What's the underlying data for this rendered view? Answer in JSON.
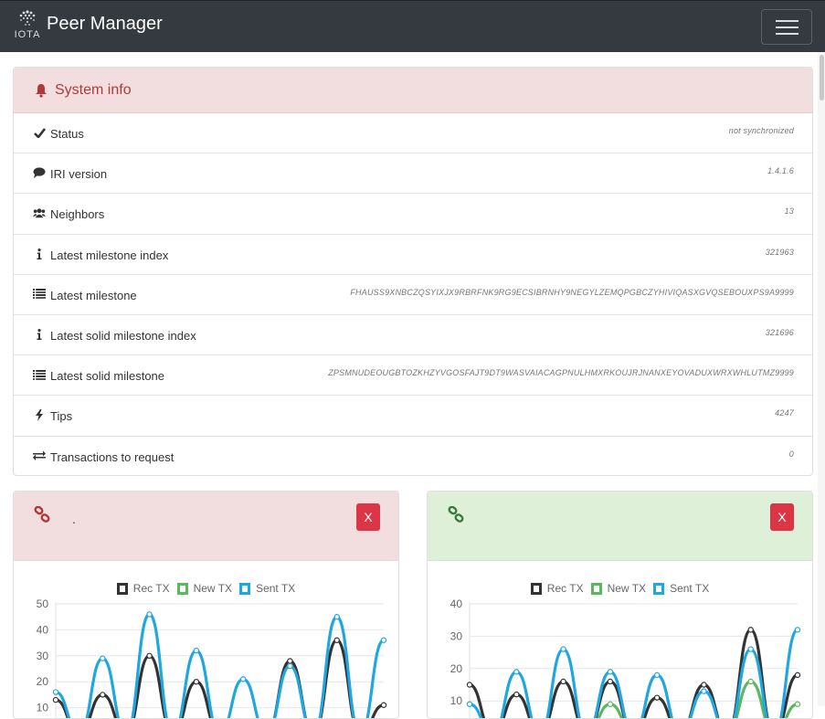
{
  "navbar": {
    "logo_text": "IOTA",
    "title": "Peer Manager",
    "menu_icon": "hamburger-icon"
  },
  "system_info": {
    "header": "System info",
    "header_icon": "bell-icon",
    "rows": [
      {
        "icon": "check-icon",
        "label": "Status",
        "value": "not synchronized"
      },
      {
        "icon": "comment-icon",
        "label": "IRI version",
        "value": "1.4.1.6"
      },
      {
        "icon": "users-icon",
        "label": "Neighbors",
        "value": "13"
      },
      {
        "icon": "info-icon",
        "label": "Latest milestone index",
        "value": "321963"
      },
      {
        "icon": "hash-icon",
        "label": "Latest milestone",
        "value": "FHAUSS9XNBCZQSYIXJX9RBRFNK9RG9ECSIBRNHY9NEGYLZEMQPGBCZYHIVIQASXGVQSEBOUXPS9A9999"
      },
      {
        "icon": "info-icon",
        "label": "Latest solid milestone index",
        "value": "321696"
      },
      {
        "icon": "hash-icon",
        "label": "Latest solid milestone",
        "value": "ZPSMNUDEOUGBTOZKHZYVGOSFAJT9DT9WASVAIACAGPNULHMXRKOUJRJNANXEYOVADUXWRXWHLUTMZ9999"
      },
      {
        "icon": "bolt-icon",
        "label": "Tips",
        "value": "4247"
      },
      {
        "icon": "exchange-icon",
        "label": "Transactions to request",
        "value": "0"
      }
    ]
  },
  "peers": [
    {
      "name": ".",
      "status_color": "#b03a3a",
      "remove_label": "X"
    },
    {
      "name": "",
      "status_color": "#3c7a3c",
      "remove_label": "X"
    }
  ],
  "colors": {
    "rec": "#333333",
    "new": "#5cb85c",
    "sent": "#1ea7e1"
  },
  "chart_data": [
    {
      "type": "line",
      "legend": [
        "Rec TX",
        "New TX",
        "Sent TX"
      ],
      "y_ticks": [
        10,
        20,
        30,
        40,
        50
      ],
      "ylim": [
        0,
        50
      ],
      "series": [
        {
          "name": "Rec TX",
          "values": [
            13,
            0,
            15,
            0,
            30,
            0,
            20,
            0,
            0,
            0,
            28,
            0,
            36,
            0,
            11
          ]
        },
        {
          "name": "New TX",
          "values": [
            0,
            0,
            0,
            0,
            0,
            0,
            0,
            0,
            0,
            0,
            0,
            0,
            0,
            0,
            0
          ]
        },
        {
          "name": "Sent TX",
          "values": [
            16,
            0,
            29,
            0,
            46,
            0,
            32,
            0,
            21,
            0,
            26,
            0,
            45,
            0,
            36
          ]
        }
      ]
    },
    {
      "type": "line",
      "legend": [
        "Rec TX",
        "New TX",
        "Sent TX"
      ],
      "y_ticks": [
        10,
        20,
        30,
        40
      ],
      "ylim": [
        0,
        40
      ],
      "series": [
        {
          "name": "Rec TX",
          "values": [
            15,
            0,
            12,
            0,
            16,
            0,
            16,
            0,
            11,
            0,
            15,
            0,
            32,
            0,
            18
          ]
        },
        {
          "name": "New TX",
          "values": [
            0,
            0,
            0,
            0,
            0,
            0,
            9,
            0,
            0,
            0,
            0,
            0,
            16,
            0,
            9
          ]
        },
        {
          "name": "Sent TX",
          "values": [
            9,
            0,
            19,
            0,
            26,
            0,
            19,
            0,
            18,
            0,
            13,
            0,
            26,
            0,
            32
          ]
        }
      ]
    }
  ]
}
